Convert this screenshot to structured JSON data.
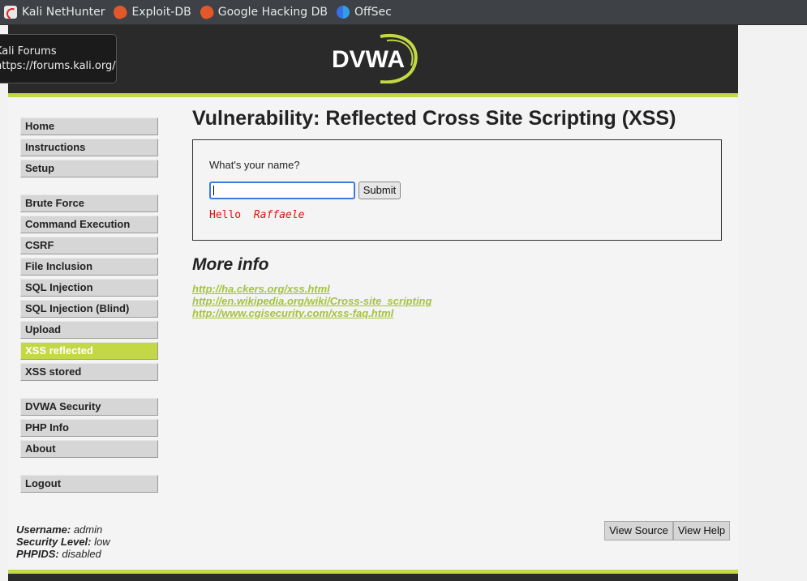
{
  "bookmarks": [
    {
      "label": "Kali NetHunter",
      "icon": "kali-icon"
    },
    {
      "label": "Exploit-DB",
      "icon": "exploit-db-icon"
    },
    {
      "label": "Google Hacking DB",
      "icon": "exploit-db-icon"
    },
    {
      "label": "OffSec",
      "icon": "offsec-icon"
    }
  ],
  "tooltip": {
    "title": "Kali Forums",
    "url": "https://forums.kali.org/"
  },
  "logo": {
    "text": "DVWA"
  },
  "menu": {
    "group1": [
      "Home",
      "Instructions",
      "Setup"
    ],
    "group2": [
      "Brute Force",
      "Command Execution",
      "CSRF",
      "File Inclusion",
      "SQL Injection",
      "SQL Injection (Blind)",
      "Upload",
      "XSS reflected",
      "XSS stored"
    ],
    "group3": [
      "DVWA Security",
      "PHP Info",
      "About"
    ],
    "group4": [
      "Logout"
    ],
    "selected": "XSS reflected"
  },
  "main": {
    "title": "Vulnerability: Reflected Cross Site Scripting (XSS)",
    "form_label": "What's your name?",
    "input_value": "",
    "submit_label": "Submit",
    "hello_prefix": "Hello ",
    "hello_name": "Raffaele"
  },
  "more_info": {
    "heading": "More info",
    "links": [
      "http://ha.ckers.org/xss.html",
      "http://en.wikipedia.org/wiki/Cross-site_scripting",
      "http://www.cgisecurity.com/xss-faq.html"
    ]
  },
  "footer": {
    "username_label": "Username:",
    "username": "admin",
    "security_label": "Security Level:",
    "security": "low",
    "phpids_label": "PHPIDS:",
    "phpids": "disabled",
    "view_source": "View Source",
    "view_help": "View Help"
  },
  "colors": {
    "accent": "#c3d845",
    "header_bg": "#2a2a2a",
    "xss_output": "#dd1111"
  }
}
